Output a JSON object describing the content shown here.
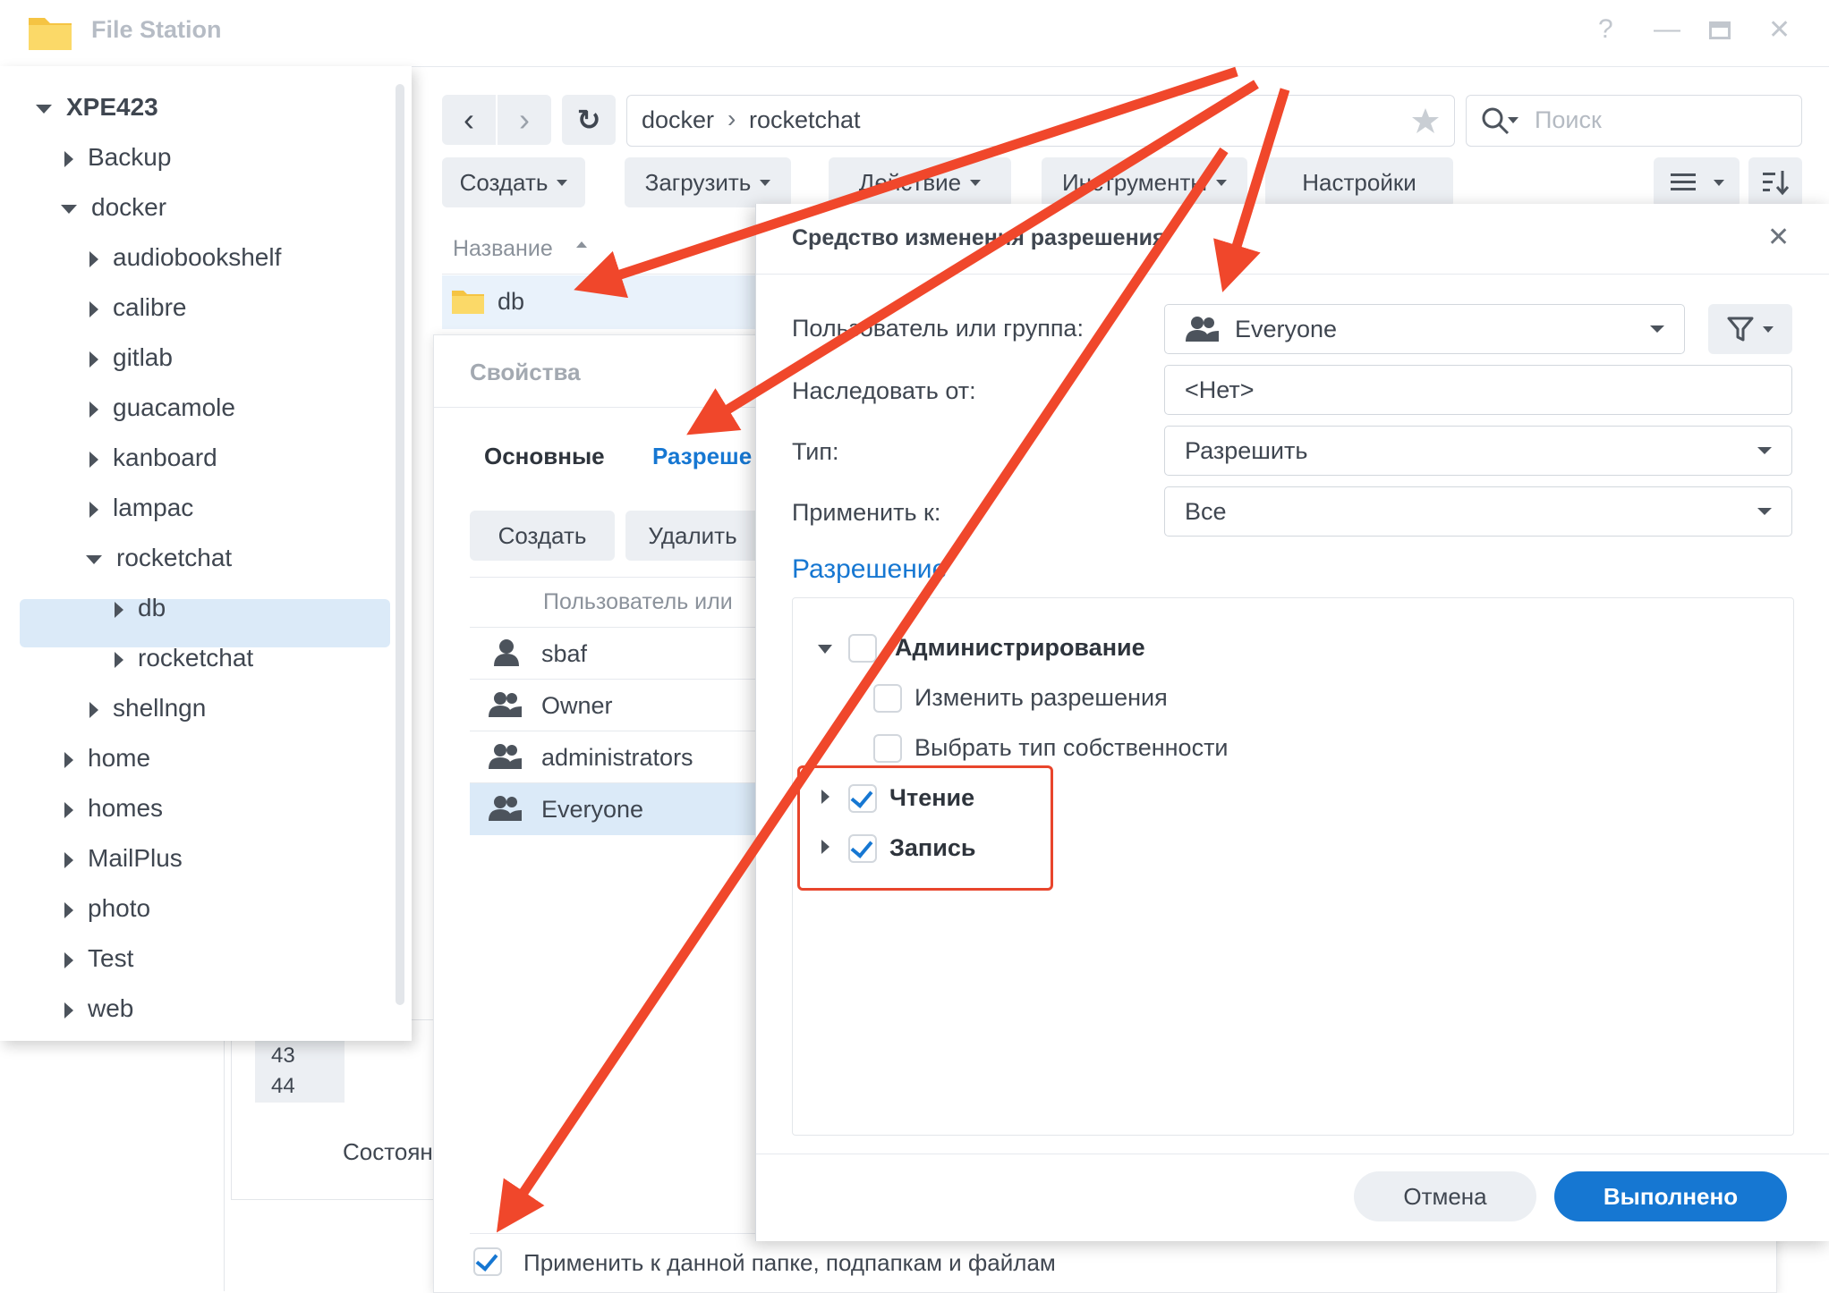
{
  "window": {
    "title": "File Station",
    "help": "?",
    "minimize": "—",
    "close": "✕"
  },
  "sidebar": {
    "items": [
      {
        "label": "XPE423",
        "expanded": true
      },
      {
        "label": "Backup"
      },
      {
        "label": "docker",
        "expanded": true
      },
      {
        "label": "audiobookshelf"
      },
      {
        "label": "calibre"
      },
      {
        "label": "gitlab"
      },
      {
        "label": "guacamole"
      },
      {
        "label": "kanboard"
      },
      {
        "label": "lampac"
      },
      {
        "label": "rocketchat",
        "expanded": true,
        "selected": true
      },
      {
        "label": "db"
      },
      {
        "label": "rocketchat"
      },
      {
        "label": "shellngn"
      },
      {
        "label": "home"
      },
      {
        "label": "homes"
      },
      {
        "label": "MailPlus"
      },
      {
        "label": "photo"
      },
      {
        "label": "Test"
      },
      {
        "label": "web"
      }
    ]
  },
  "toolbar": {
    "back": "‹",
    "forward": "›",
    "refresh": "↻",
    "path": [
      "docker",
      "rocketchat"
    ],
    "path_sep": "›",
    "search_placeholder": "Поиск",
    "buttons": [
      "Создать",
      "Загрузить",
      "Действие",
      "Инструменты",
      "Настройки"
    ]
  },
  "filelist": {
    "column_name": "Название",
    "rows": [
      "db"
    ]
  },
  "background_panel": {
    "numbers": [
      "43",
      "44"
    ],
    "status_label": "Состоян"
  },
  "properties": {
    "title": "Свойства",
    "tabs": [
      "Основные",
      "Разреше"
    ],
    "buttons": [
      "Создать",
      "Удалить"
    ],
    "column_user": "Пользователь или",
    "users": [
      {
        "name": "sbaf",
        "icon": "single-user-icon"
      },
      {
        "name": "Owner",
        "icon": "group-icon"
      },
      {
        "name": "administrators",
        "icon": "group-icon"
      },
      {
        "name": "Everyone",
        "icon": "group-icon",
        "selected": true
      }
    ],
    "apply_all_label": "Применить к данной папке, подпапкам и файлам",
    "apply_all_checked": true
  },
  "dialog": {
    "title": "Средство изменения разрешения",
    "close": "✕",
    "fields": {
      "user_label": "Пользователь или группа:",
      "user_value": "Everyone",
      "inherit_label": "Наследовать от:",
      "inherit_value": "<Нет>",
      "type_label": "Тип:",
      "type_value": "Разрешить",
      "apply_label": "Применить к:",
      "apply_value": "Все"
    },
    "perm_section": "Разрешение",
    "permissions": [
      {
        "label": "Администрирование",
        "checked": false,
        "bold": true
      },
      {
        "label": "Изменить разрешения",
        "checked": false
      },
      {
        "label": "Выбрать тип собственности",
        "checked": false
      },
      {
        "label": "Чтение",
        "checked": true,
        "bold": true
      },
      {
        "label": "Запись",
        "checked": true,
        "bold": true
      }
    ],
    "cancel": "Отмена",
    "ok": "Выполнено"
  },
  "colors": {
    "accent": "#1677d2",
    "annotation": "#f0472b",
    "selection": "#dbeaf8"
  }
}
